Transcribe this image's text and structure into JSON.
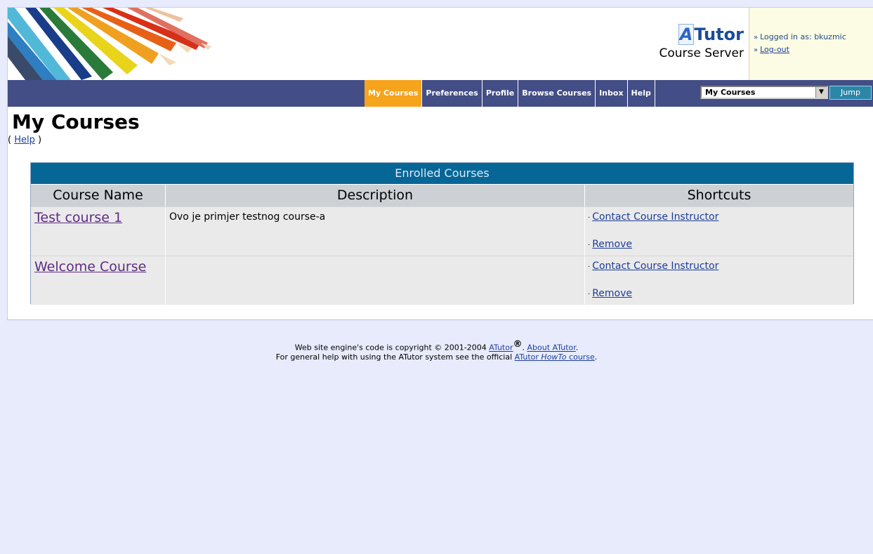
{
  "header": {
    "logo_prefix": "A",
    "logo_suffix": "Tutor",
    "subtitle": "Course Server",
    "logged_in_label": "Logged in as: bkuzmic",
    "logout_label": "Log-out",
    "arrow_glyph": "»"
  },
  "nav": {
    "items": [
      "My Courses",
      "Preferences",
      "Profile",
      "Browse Courses",
      "Inbox",
      "Help"
    ],
    "active_index": 0,
    "jump_select_value": "My Courses",
    "jump_button": "Jump"
  },
  "page": {
    "title": "My Courses",
    "help_open": "(",
    "help_link": "Help",
    "help_close": ")"
  },
  "table": {
    "caption": "Enrolled Courses",
    "columns": [
      "Course Name",
      "Description",
      "Shortcuts"
    ],
    "rows": [
      {
        "name": "Test course 1",
        "description": "Ovo je primjer testnog course-a",
        "shortcuts": [
          "Contact Course Instructor",
          "Remove"
        ]
      },
      {
        "name": "Welcome Course",
        "description": "",
        "shortcuts": [
          "Contact Course Instructor",
          "Remove"
        ]
      }
    ]
  },
  "footer": {
    "line1_prefix": "Web site engine's code is copyright © 2001-2004",
    "atutor_link": "ATutor",
    "reg_mark": "®",
    "about_link": "About ATutor",
    "line2_prefix": "For general help with using the ATutor system see the official",
    "howto_link_a": "ATutor",
    "howto_link_b": "HowTo",
    "howto_link_c": "course"
  },
  "colors": {
    "nav_bg": "#434d86",
    "nav_active": "#f6a41b",
    "caption_bg": "#066696",
    "page_bg": "#e7ebfb",
    "link": "#1d3e99",
    "visited_link": "#5d2c83"
  }
}
